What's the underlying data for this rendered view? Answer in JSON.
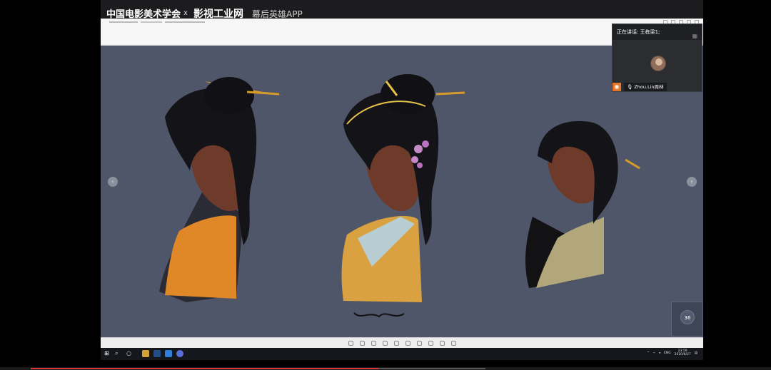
{
  "branding": {
    "org_name": "中国电影美术学会",
    "separator": "x",
    "site_name": "影视工业网",
    "app_name": "幕后英雄APP"
  },
  "speaker_panel": {
    "label": "正在讲话: 王栋梁1;",
    "participant_name": "Zhou.Lin周林"
  },
  "thumbnail": {
    "value": "36"
  },
  "taskbar": {
    "lang": "ENG",
    "time": "23:59",
    "date": "2020/8/27"
  },
  "video_progress": {
    "played_fraction": 0.45
  },
  "colors": {
    "canvas_bg": "#4f5669",
    "accent_orange": "#e6762b",
    "progress_red": "#dd3333"
  },
  "icons": {
    "nav_left": "chevron-left-icon",
    "nav_right": "chevron-right-icon",
    "mic": "microphone-icon",
    "user": "user-icon"
  }
}
